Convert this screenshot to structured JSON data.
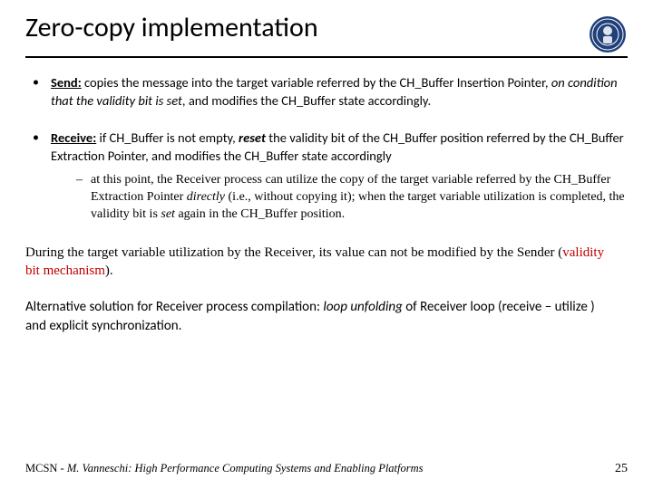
{
  "title": "Zero-copy implementation",
  "bullets": {
    "send": {
      "label": "Send:",
      "t1": " copies the message into the target variable referred by the CH_Buffer Insertion Pointer, ",
      "ital": "on condition that the validity bit is set",
      "t2": ", and modifies the CH_Buffer state accordingly."
    },
    "receive": {
      "label": "Receive:",
      "t1": " if CH_Buffer is not empty, ",
      "reset": "reset",
      "t2": " the validity bit of the CH_Buffer position referred by the CH_Buffer Extraction Pointer, and modifies the CH_Buffer state accordingly"
    },
    "sub": {
      "t1": "at this point, the Receiver process can utilize the copy of the target variable referred by the CH_Buffer Extraction Pointer ",
      "directly": "directly",
      "t2": " (i.e., without copying it); when the target variable utilization is completed, the validity bit is ",
      "set": "set",
      "t3": " again in the CH_Buffer position."
    }
  },
  "mid": {
    "t1": "During the target variable utilization by the Receiver, its value can not be modified by the Sender (",
    "red": "validity bit mechanism",
    "t2": ")."
  },
  "alt": {
    "t1": "Alternative solution for Receiver process compilation: ",
    "ital": "loop unfolding ",
    "t2": "of Receiver loop (receive – utilize ) and explicit synchronization."
  },
  "footer": {
    "prefix": "MCSN  -   ",
    "author": "M. Vanneschi: High Performance Computing Systems and Enabling Platforms",
    "page": "25"
  }
}
